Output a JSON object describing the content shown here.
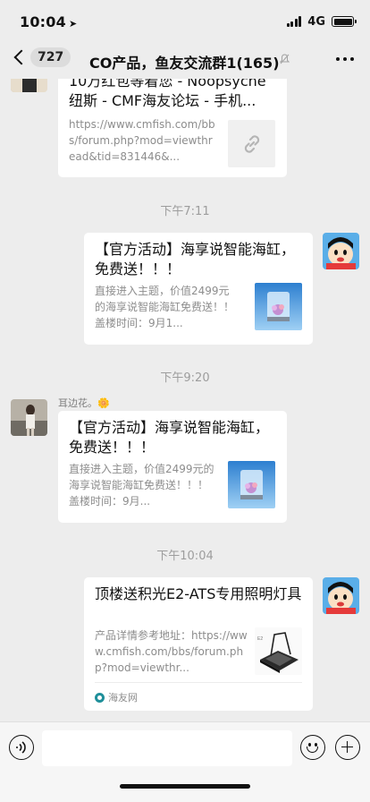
{
  "status_bar": {
    "time": "10:04",
    "network": "4G"
  },
  "nav": {
    "unread_count": "727",
    "title": "CO产品，鱼友交流群1(165)"
  },
  "messages": [
    {
      "kind": "link-card",
      "direction": "incoming",
      "title": "10万红包等着您 - Noopsyche纽斯 - CMF海友论坛 - 手机...",
      "description": "https://www.cmfish.com/bbs/forum.php?mod=viewthread&tid=831446&...",
      "thumbnail_icon": "link-icon"
    },
    {
      "kind": "time",
      "text": "下午7:11"
    },
    {
      "kind": "link-card",
      "direction": "outgoing",
      "title": "【官方活动】海享说智能海缸，免费送！！！",
      "description": "直接进入主题，价值2499元的海享说智能海缸免费送！！盖楼时间：9月1...",
      "thumbnail_icon": "aquarium-thumbnail"
    },
    {
      "kind": "time",
      "text": "下午9:20"
    },
    {
      "kind": "link-card",
      "direction": "incoming",
      "sender": "耳边花。",
      "sender_emoji": "🌼",
      "title": "【官方活动】海享说智能海缸，免费送！！！",
      "description": "直接进入主题，价值2499元的海享说智能海缸免费送！！！盖楼时间：9月...",
      "thumbnail_icon": "aquarium-thumbnail"
    },
    {
      "kind": "time",
      "text": "下午10:04"
    },
    {
      "kind": "link-card",
      "direction": "outgoing",
      "title": "顶楼送积光E2-ATS专用照明灯具",
      "description": "产品详情参考地址：https://www.cmfish.com/bbs/forum.php?mod=viewthr...",
      "thumbnail_icon": "light-fixture-thumbnail",
      "source": "海友网"
    }
  ],
  "input_bar": {
    "placeholder": ""
  },
  "colors": {
    "background": "#ededed",
    "card": "#ffffff",
    "meta_text": "#9d9d9d"
  }
}
